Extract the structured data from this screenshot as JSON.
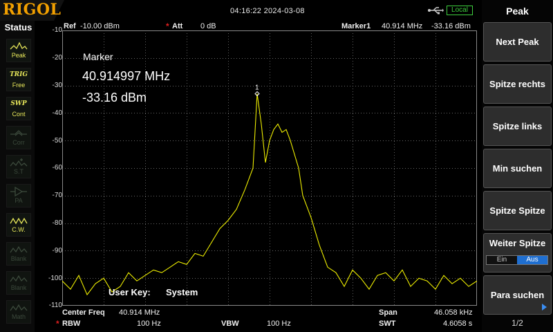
{
  "header": {
    "brand": "RIGOL",
    "datetime": "04:16:22 2024-03-08",
    "remote_state": "Local",
    "usb_icon": "usb-icon"
  },
  "status_panel": {
    "title": "Status",
    "items": [
      {
        "top": "",
        "sub": "Peak",
        "icon": "peak-icon",
        "active": true
      },
      {
        "top": "TRIG",
        "sub": "Free",
        "icon": "",
        "active": true
      },
      {
        "top": "SWP",
        "sub": "Cont",
        "icon": "",
        "active": true
      },
      {
        "top": "",
        "sub": "Corr",
        "icon": "corr-icon",
        "active": false
      },
      {
        "top": "",
        "sub": "S.T",
        "icon": "st-icon",
        "active": false
      },
      {
        "top": "",
        "sub": "PA",
        "icon": "pa-icon",
        "active": false
      },
      {
        "top": "",
        "sub": "C.W.",
        "icon": "cw-icon",
        "active": true
      },
      {
        "top": "",
        "sub": "Blank",
        "icon": "blank-icon",
        "active": false
      },
      {
        "top": "",
        "sub": "Blank",
        "icon": "blank-icon",
        "active": false
      },
      {
        "top": "",
        "sub": "Math",
        "icon": "math-icon",
        "active": false
      }
    ]
  },
  "display": {
    "ref_label": "Ref",
    "ref_value": "-10.00 dBm",
    "att_label": "Att",
    "att_value": "0 dB",
    "marker_header_label": "Marker1",
    "marker_header_freq": "40.914 MHz",
    "marker_header_amp": "-33.16 dBm",
    "marker_box": {
      "label": "Marker",
      "freq": "40.914997 MHz",
      "amp": "-33.16 dBm"
    },
    "marker_number": "1",
    "user_key_label": "User Key:",
    "user_key_value": "System",
    "y_ticks": [
      "-10",
      "-20",
      "-30",
      "-40",
      "-50",
      "-60",
      "-70",
      "-80",
      "-90",
      "-100",
      "-110"
    ]
  },
  "footer": {
    "center_freq_label": "Center Freq",
    "center_freq_value": "40.914 MHz",
    "span_label": "Span",
    "span_value": "46.058 kHz",
    "rbw_label": "RBW",
    "rbw_value": "100 Hz",
    "vbw_label": "VBW",
    "vbw_value": "100 Hz",
    "swt_label": "SWT",
    "swt_value": "4.6058 s"
  },
  "menu": {
    "title": "Peak",
    "keys": [
      "Next Peak",
      "Spitze rechts",
      "Spitze links",
      "Min suchen",
      "Spitze Spitze",
      "Weiter Spitze",
      "Para suchen"
    ],
    "weiter_options": [
      "Ein",
      "Aus"
    ],
    "weiter_selected": "Aus",
    "page": "1/2"
  },
  "colors": {
    "trace": "#f0f000",
    "grid": "#8a8a8a",
    "brand": "#f2a000",
    "local": "#3ecf3e",
    "selected": "#1f6fd1"
  },
  "chart_data": {
    "type": "line",
    "ylim": [
      -110,
      -10
    ],
    "y_unit": "dBm",
    "x_center": "40.914 MHz",
    "x_span": "46.058 kHz",
    "grid": true,
    "series": [
      {
        "x": [
          0,
          2,
          4,
          6,
          8,
          10,
          12,
          14,
          16,
          18,
          20,
          22,
          24,
          26,
          28,
          30,
          32,
          34,
          36,
          38,
          40,
          42,
          44,
          45,
          46,
          47,
          48,
          49,
          50,
          51,
          52,
          53,
          54,
          55,
          56,
          57,
          58,
          60,
          62,
          64,
          66,
          68,
          70,
          72,
          74,
          76,
          78,
          80,
          82,
          84,
          86,
          88,
          90,
          92,
          94,
          96,
          98,
          100
        ],
        "y": [
          -101,
          -104,
          -99,
          -106,
          -102,
          -100,
          -105,
          -103,
          -98,
          -101,
          -99,
          -97,
          -98,
          -96,
          -94,
          -95,
          -91,
          -92,
          -87,
          -82,
          -79,
          -75,
          -68,
          -64,
          -60,
          -33,
          -44,
          -58,
          -50,
          -46,
          -44,
          -47,
          -46,
          -50,
          -55,
          -60,
          -70,
          -78,
          -88,
          -96,
          -98,
          -103,
          -97,
          -100,
          -104,
          -99,
          -98,
          -101,
          -97,
          -103,
          -100,
          -101,
          -104,
          -99,
          -102,
          -100,
          -103,
          -101
        ]
      }
    ]
  }
}
